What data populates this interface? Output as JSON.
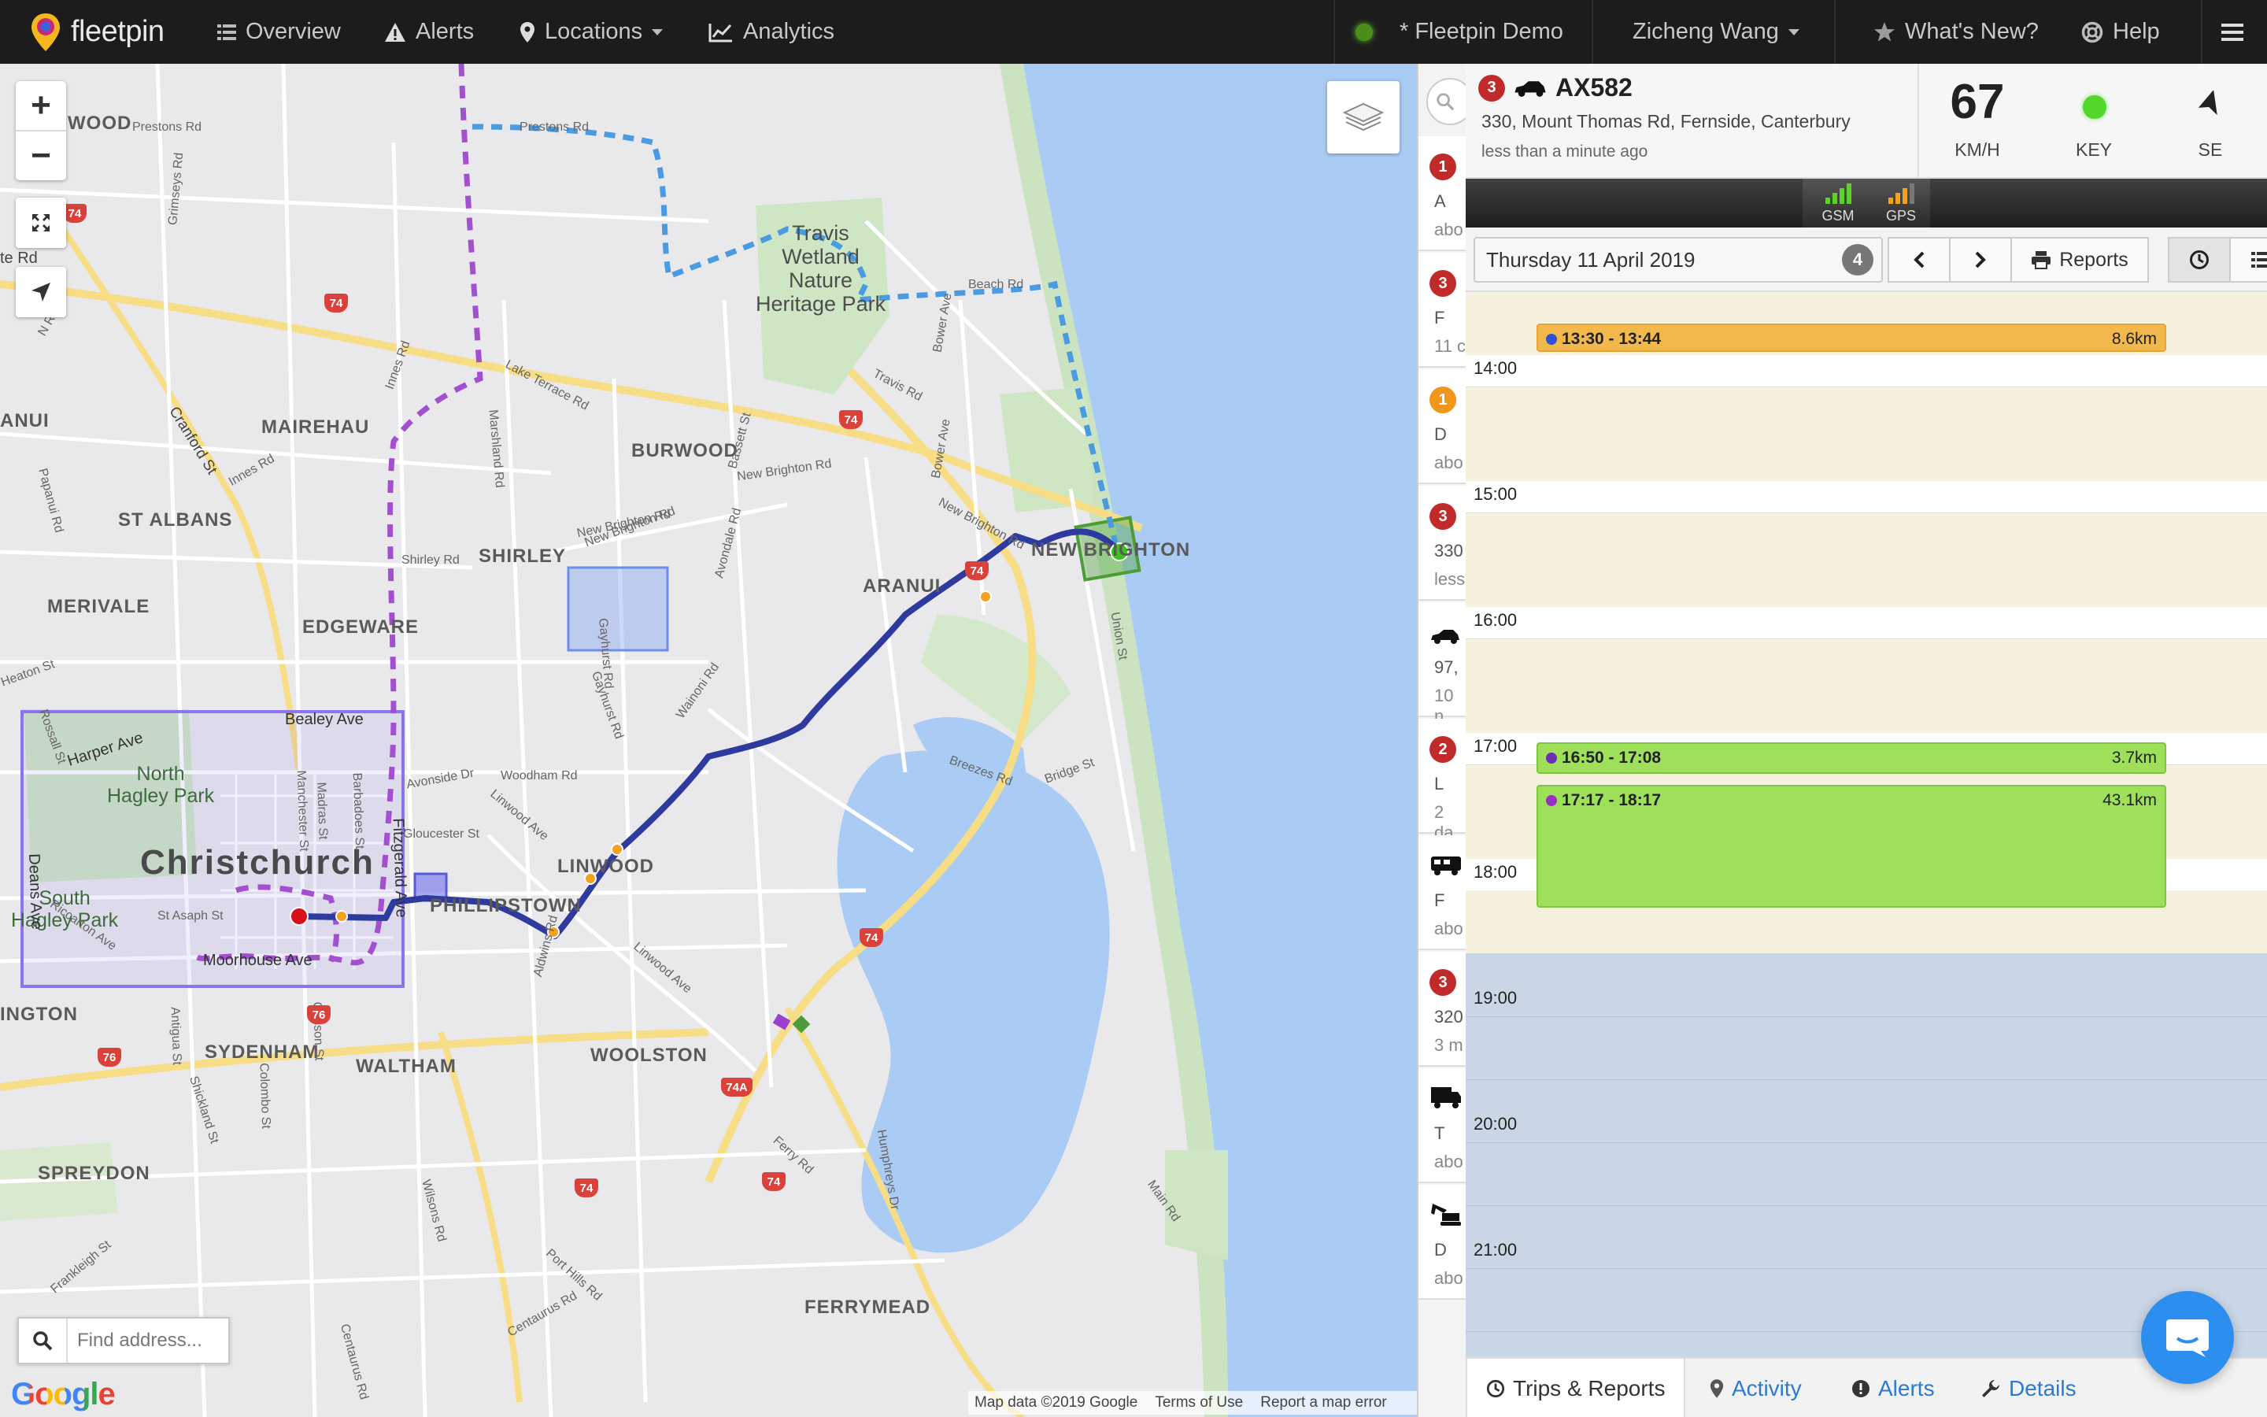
{
  "navbar": {
    "logo": "fleetpin",
    "items": [
      {
        "label": "Overview",
        "icon": "list-icon"
      },
      {
        "label": "Alerts",
        "icon": "warning-icon"
      },
      {
        "label": "Locations",
        "icon": "map-marker-icon"
      },
      {
        "label": "Analytics",
        "icon": "chart-line-icon"
      }
    ],
    "account": "* Fleetpin Demo",
    "user": "Zicheng Wang",
    "whats_new": "What's New?",
    "help": "Help"
  },
  "map": {
    "labels": {
      "christchurch": "Christchurch",
      "north_hagley": "North\nHagley Park",
      "south_hagley": "South\nHagley Park",
      "travis": "Travis\nWetland\nNature\nHeritage Park",
      "mairehau": "MAIREHAU",
      "st_albans": "ST ALBANS",
      "merivale": "MERIVALE",
      "edgeware": "EDGEWARE",
      "shirley": "SHIRLEY",
      "burwood": "BURWOOD",
      "aranui": "ARANUI",
      "new_brighton": "NEW BRIGHTON",
      "linwood": "LINWOOD",
      "phillipstown": "PHILLIPSTOWN",
      "woolston": "WOOLSTON",
      "waltham": "WALTHAM",
      "sydenham": "SYDENHAM",
      "spreydon": "SPREYDON",
      "ferrymead": "FERRYMEAD",
      "ington": "INGTON",
      "anui": "ANUI",
      "wood": "WOOD"
    },
    "roads": {
      "bealey": "Bealey Ave",
      "harper": "Harper Ave",
      "deans": "Deans Ave",
      "moorhouse": "Moorhouse Ave",
      "fitzgerald": "Fitzgerald Ave",
      "st_asaph": "St Asaph St",
      "gloucester": "Gloucester St",
      "avonside": "Avonside Dr",
      "woodham": "Woodham Rd",
      "linwood_ave": "Linwood Ave",
      "new_brighton_rd": "New Brighton Rd",
      "breezes": "Breezes Rd",
      "bridge": "Bridge St",
      "marshland": "Marshland Rd",
      "lake_terrace": "Lake Terrace Rd",
      "travis_rd": "Travis Rd",
      "bower": "Bower Ave",
      "cranford": "Cranford St",
      "innes": "Innes Rd",
      "prestons": "Prestons Rd",
      "ferry": "Ferry Rd",
      "main_rd": "Main Rd",
      "port_hills": "Port Hills Rd",
      "wilsons": "Wilsons Rd",
      "colombo": "Colombo St",
      "shirley_rd": "Shirley Rd",
      "gayhurst": "Gayhurst Rd",
      "wainoni": "Wainoni Rd",
      "union": "Union St",
      "avondale": "Avondale Rd",
      "bassett": "Bassett St",
      "heaton": "Heaton St",
      "rossall": "Rossall St",
      "riccarton": "Riccarton Ave",
      "madras": "Madras St",
      "barbadoes": "Barbadoes St",
      "manchester": "Manchester St",
      "antigua": "Antigua St",
      "gasson": "Gasson St",
      "shickland": "Shickland St",
      "frankleigh": "Frankleigh St",
      "centaurus": "Centaurus Rd",
      "humphreys": "Humphreys Dr",
      "grimseys": "Grimseys Rd",
      "aldwins": "Aldwins Rd",
      "papanui": "Papanui Rd",
      "beach": "Beach Rd",
      "n_rd": "N Rd",
      "te_rd": "te Rd"
    },
    "shields": [
      "74",
      "74",
      "74",
      "74",
      "74",
      "74",
      "74",
      "76",
      "76",
      "74A"
    ],
    "find_placeholder": "Find address...",
    "google": "Google",
    "attribution": [
      "Map data ©2019 Google",
      "Terms of Use",
      "Report a map error"
    ],
    "zoom_in": "+",
    "zoom_out": "−"
  },
  "strip": {
    "rows": [
      {
        "badge": "1",
        "color": "red",
        "l1": "A",
        "l2": "abo"
      },
      {
        "badge": "3",
        "color": "red",
        "l1": "F",
        "l2": "11 c"
      },
      {
        "badge": "1",
        "color": "orange",
        "l1": "D",
        "l2": "abo"
      },
      {
        "badge": "3",
        "color": "red",
        "l1": "330",
        "l2": "less"
      },
      {
        "badge": "",
        "color": "",
        "l1": "97,",
        "l2": "10 n"
      },
      {
        "badge": "2",
        "color": "red",
        "l1": "L",
        "l2": "2 da"
      },
      {
        "badge": "",
        "color": "",
        "l1": "F",
        "l2": "abo"
      },
      {
        "badge": "3",
        "color": "red",
        "l1": "320",
        "l2": "3 m"
      },
      {
        "badge": "",
        "color": "",
        "l1": "T",
        "l2": "abo"
      },
      {
        "badge": "",
        "color": "",
        "l1": "D",
        "l2": "abo"
      }
    ]
  },
  "vehicle": {
    "badge": "3",
    "name": "AX582",
    "address": "330, Mount Thomas Rd, Fernside, Canterbury",
    "updated": "less than a minute ago",
    "speed": "67",
    "speed_unit": "KM/H",
    "key_label": "KEY",
    "heading": "SE",
    "gsm": "GSM",
    "gps": "GPS"
  },
  "toolbar": {
    "date": "Thursday 11 April 2019",
    "count": "4",
    "reports": "Reports"
  },
  "timeline": {
    "hours": [
      "14:00",
      "15:00",
      "16:00",
      "17:00",
      "18:00",
      "19:00",
      "20:00",
      "21:00"
    ],
    "trips": [
      {
        "time": "13:30 - 13:44",
        "distance": "8.6km",
        "color": "#f2b84b",
        "dot": "#2f4fd6"
      },
      {
        "time": "16:50 - 17:08",
        "distance": "3.7km",
        "color": "#9ee05a",
        "dot": "#6b2fb5"
      },
      {
        "time": "17:17 - 18:17",
        "distance": "43.1km",
        "color": "#9ee05a",
        "dot": "#9a2fc0"
      }
    ]
  },
  "tabs": [
    {
      "label": "Trips & Reports"
    },
    {
      "label": "Activity"
    },
    {
      "label": "Alerts"
    },
    {
      "label": "Details"
    }
  ]
}
